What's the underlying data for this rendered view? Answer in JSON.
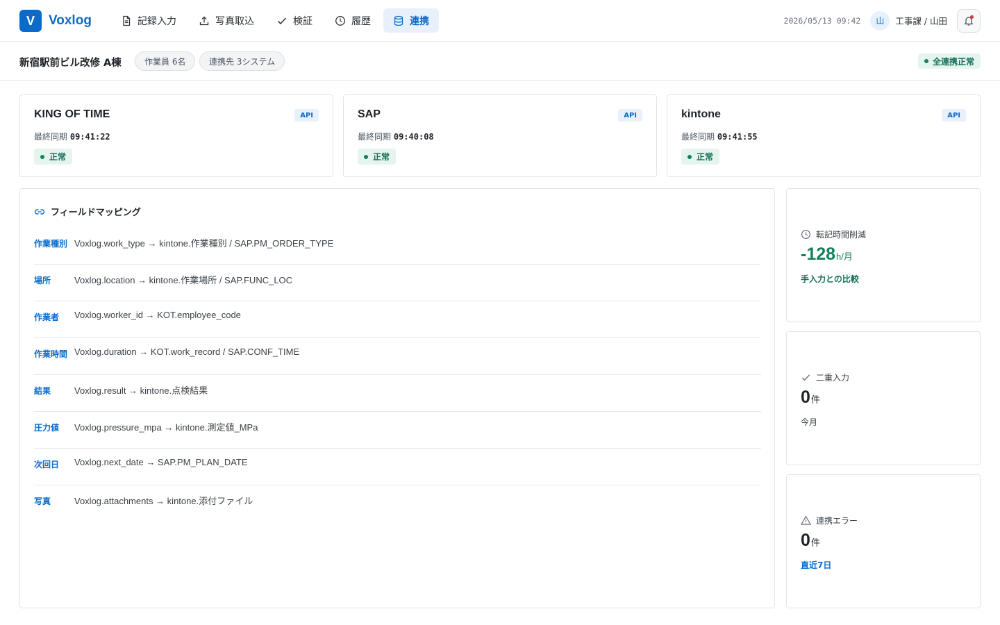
{
  "app": {
    "logo_letter": "V",
    "name": "Voxlog"
  },
  "nav": [
    {
      "label": "記録入力",
      "icon": "document-icon"
    },
    {
      "label": "写真取込",
      "icon": "upload-icon"
    },
    {
      "label": "検証",
      "icon": "check-icon"
    },
    {
      "label": "履歴",
      "icon": "clock-icon"
    },
    {
      "label": "連携",
      "icon": "database-icon",
      "active": true
    }
  ],
  "header": {
    "datetime": "2026/05/13 09:42",
    "avatar": "山",
    "user": "工事課 / 山田"
  },
  "project": {
    "name": "新宿駅前ビル改修 A棟",
    "workers": "作業員 6名",
    "partners": "連携先 3システム",
    "status": "全連携正常"
  },
  "systems": [
    {
      "name": "KING OF TIME",
      "badge": "API",
      "sync_label": "最終同期",
      "sync_time": "09:41:22",
      "status": "正常"
    },
    {
      "name": "SAP",
      "badge": "API",
      "sync_label": "最終同期",
      "sync_time": "09:40:08",
      "status": "正常"
    },
    {
      "name": "kintone",
      "badge": "API",
      "sync_label": "最終同期",
      "sync_time": "09:41:55",
      "status": "正常"
    }
  ],
  "mapping": {
    "title": "フィールドマッピング",
    "rows": [
      {
        "key": "作業種別",
        "value": "Voxlog.work_type → kintone.作業種別 / SAP.PM_ORDER_TYPE"
      },
      {
        "key": "場所",
        "value": "Voxlog.location → kintone.作業場所 / SAP.FUNC_LOC"
      },
      {
        "key": "作業者",
        "value": "Voxlog.worker_id → KOT.employee_code"
      },
      {
        "key": "作業時間",
        "value": "Voxlog.duration → KOT.work_record / SAP.CONF_TIME"
      },
      {
        "key": "結果",
        "value": "Voxlog.result → kintone.点検結果"
      },
      {
        "key": "圧力値",
        "value": "Voxlog.pressure_mpa → kintone.測定値_MPa"
      },
      {
        "key": "次回日",
        "value": "Voxlog.next_date → SAP.PM_PLAN_DATE"
      },
      {
        "key": "写真",
        "value": "Voxlog.attachments → kintone.添付ファイル"
      }
    ]
  },
  "stats": [
    {
      "label": "転記時間削減",
      "icon": "clock-icon",
      "value": "-128",
      "unit": "h/月",
      "note": "手入力との比較"
    },
    {
      "label": "二重入力",
      "icon": "check-icon",
      "value": "0",
      "unit": "件",
      "note": "今月"
    },
    {
      "label": "連携エラー",
      "icon": "warning-icon",
      "value": "0",
      "unit": "件",
      "note": "直近7日"
    }
  ],
  "colors": {
    "accent": "#0b6bcb",
    "success": "#12805c",
    "success_bg": "#e6f4ee",
    "accent_bg": "#e8f1fb"
  }
}
